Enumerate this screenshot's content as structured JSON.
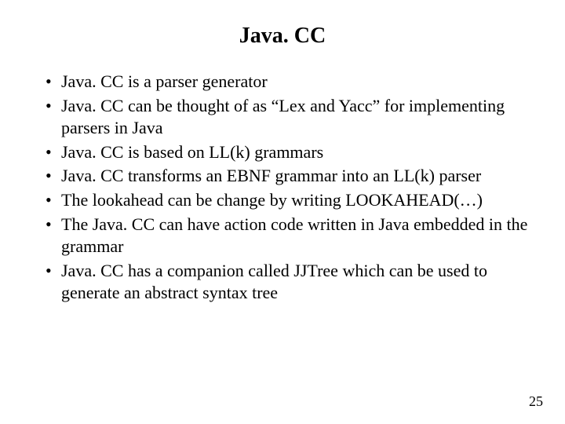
{
  "title": "Java. CC",
  "bullets": [
    "Java. CC is a parser generator",
    "Java. CC can be thought of as “Lex and Yacc” for implementing parsers in Java",
    "Java. CC is based on LL(k) grammars",
    "Java. CC transforms an EBNF grammar into an LL(k) parser",
    "The lookahead can be change by writing LOOKAHEAD(…)",
    "The Java. CC can have action code written in Java embedded  in the grammar",
    "Java. CC has a companion called JJTree which can be used to generate an abstract syntax tree"
  ],
  "page_number": "25"
}
